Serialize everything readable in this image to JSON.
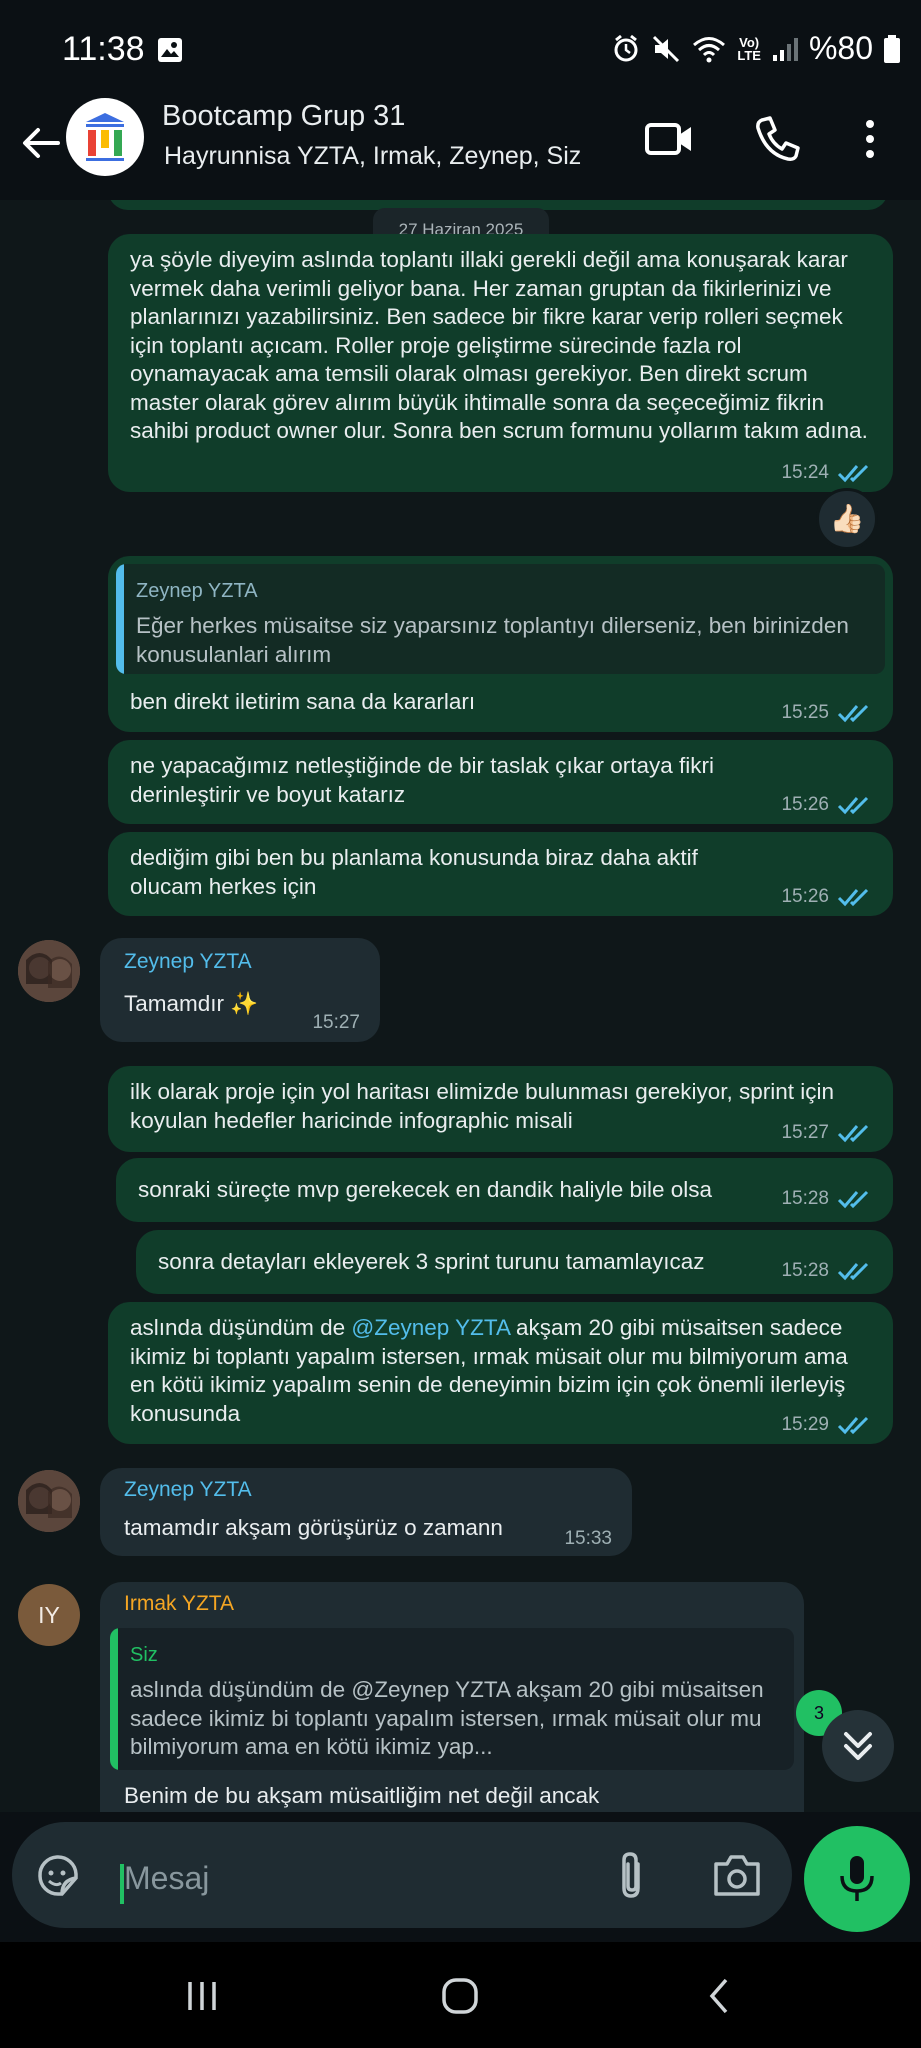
{
  "status": {
    "time": "11:38",
    "battery": "%80",
    "network": "LTE"
  },
  "header": {
    "title": "Bootcamp Grup 31",
    "subtitle": "Hayrunnisa YZTA, Irmak, Zeynep, Siz"
  },
  "chat": {
    "date": "27 Haziran 2025",
    "messages": [
      {
        "type": "out",
        "text": "ya şöyle diyeyim aslında toplantı illaki gerekli değil ama konuşarak karar vermek daha verimli geliyor bana. Her zaman gruptan da fikirlerinizi ve planlarınızı yazabilirsiniz. Ben sadece bir fikre karar verip rolleri seçmek için toplantı açıcam. Roller proje geliştirme sürecinde fazla rol oynamayacak ama temsili olarak olması gerekiyor. Ben direkt scrum master olarak görev alırım büyük ihtimalle sonra da seçeceğimiz fikrin sahibi product owner olur. Sonra ben scrum formunu yollarım takım adına.",
        "time": "15:24",
        "reaction": "👍🏻"
      },
      {
        "type": "out",
        "reply_name": "Zeynep YZTA",
        "reply_text": "Eğer herkes müsaitse siz yaparsınız toplantıyı dilerseniz, ben birinizden konusulanlari alırım",
        "text": "ben direkt iletirim sana da kararları",
        "time": "15:25"
      },
      {
        "type": "out",
        "text": "ne yapacağımız netleştiğinde de bir taslak çıkar ortaya fikri derinleştirir ve boyut katarız",
        "time": "15:26"
      },
      {
        "type": "out",
        "text": "dediğim gibi ben bu planlama konusunda biraz daha aktif olucam herkes için",
        "time": "15:26"
      },
      {
        "type": "in",
        "sender": "Zeynep YZTA",
        "text": "Tamamdır ✨",
        "time": "15:27"
      },
      {
        "type": "out",
        "text": "ilk olarak proje için yol haritası elimizde bulunması gerekiyor, sprint için koyulan hedefler haricinde infographic misali",
        "time": "15:27"
      },
      {
        "type": "out",
        "text": "sonraki süreçte mvp gerekecek en dandik haliyle bile olsa",
        "time": "15:28"
      },
      {
        "type": "out",
        "text": "sonra detayları ekleyerek 3 sprint turunu tamamlayıcaz",
        "time": "15:28"
      },
      {
        "type": "out",
        "mention": "@Zeynep YZTA",
        "text_before": "aslında düşündüm de",
        "text_after": "akşam 20 gibi müsaitsen sadece ikimiz bi toplantı yapalım istersen, ırmak müsait olur mu bilmiyorum ama en kötü ikimiz yapalım senin de deneyimin bizim için çok önemli ilerleyiş konusunda",
        "time": "15:29"
      },
      {
        "type": "in",
        "sender": "Zeynep YZTA",
        "text": "tamamdır akşam görüşürüz o zamann",
        "time": "15:33"
      },
      {
        "type": "in",
        "sender": "Irmak YZTA",
        "avatar_initials": "IY",
        "reply_name": "Siz",
        "reply_text": "aslında düşündüm de @Zeynep YZTA akşam 20 gibi müsaitsen sadece ikimiz bi toplantı yapalım istersen, ırmak müsait olur mu bilmiyorum ama en kötü ikimiz yap...",
        "text": "Benim de bu akşam müsaitliğim net değil ancak"
      }
    ],
    "unread_count": "3"
  },
  "composer": {
    "placeholder": "Mesaj"
  },
  "colors": {
    "outgoing": "#103d2a",
    "incoming": "#1f2c32",
    "accent": "#21c063",
    "tick": "#53bdeb"
  }
}
